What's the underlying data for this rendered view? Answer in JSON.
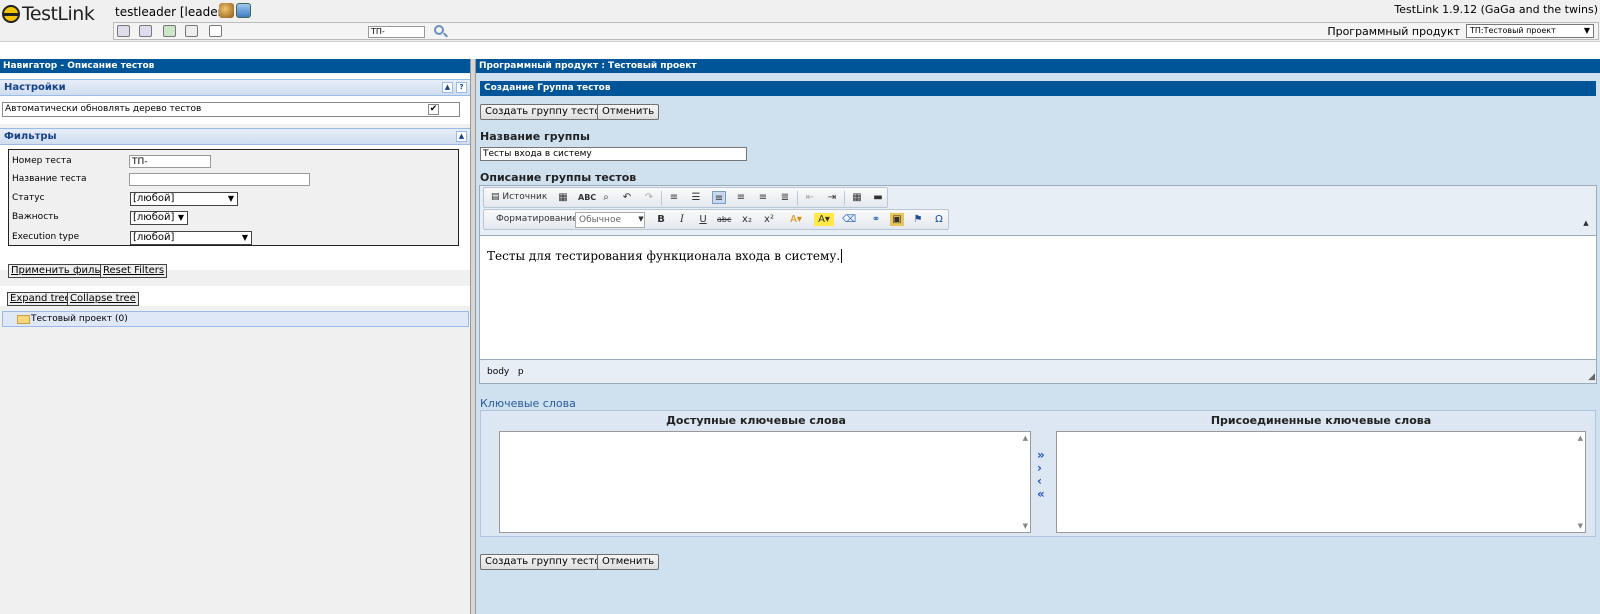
{
  "header": {
    "logo_text": "TestLink",
    "user": "testleader [leader]",
    "version": "TestLink 1.9.12 (GaGa and the twins)",
    "search_value": "ТП-",
    "product_label": "Программный продукт",
    "product_value": "ТП:Тестовый проект"
  },
  "left": {
    "panel_title": "Навигатор - Описание тестов",
    "settings": {
      "title": "Настройки",
      "auto_refresh_label": "Автоматически обновлять дерево тестов",
      "auto_refresh_checked": "✔"
    },
    "filters": {
      "title": "Фильтры",
      "test_number_label": "Номер теста",
      "test_number_value": "ТП-",
      "test_name_label": "Название теста",
      "test_name_value": "",
      "status_label": "Статус",
      "status_value": "[любой]",
      "importance_label": "Важность",
      "importance_value": "[любой]",
      "exec_type_label": "Execution type",
      "exec_type_value": "[любой]",
      "apply_button": "Применить фильтр",
      "reset_button": "Reset Filters"
    },
    "tree": {
      "expand_button": "Expand tree",
      "collapse_button": "Collapse tree",
      "root_item": "Тестовый проект (0)"
    }
  },
  "right": {
    "panel_title": "Программный продукт : Тестовый проект",
    "form_title": "Создание Группа тестов",
    "create_button": "Создать группу тестов",
    "cancel_button": "Отменить",
    "group_name_label": "Название группы",
    "group_name_value": "Тесты входа в систему",
    "description_label": "Описание группы тестов",
    "editor": {
      "source_label": "Источник",
      "format_label": "Форматирование",
      "format_value": "Обычное",
      "content": "Тесты для тестирования функционала входа в систему.",
      "path": [
        "body",
        "p"
      ]
    },
    "keywords": {
      "title": "Ключевые слова",
      "available_label": "Доступные ключевые слова",
      "assigned_label": "Присоединенные ключевые слова"
    }
  }
}
